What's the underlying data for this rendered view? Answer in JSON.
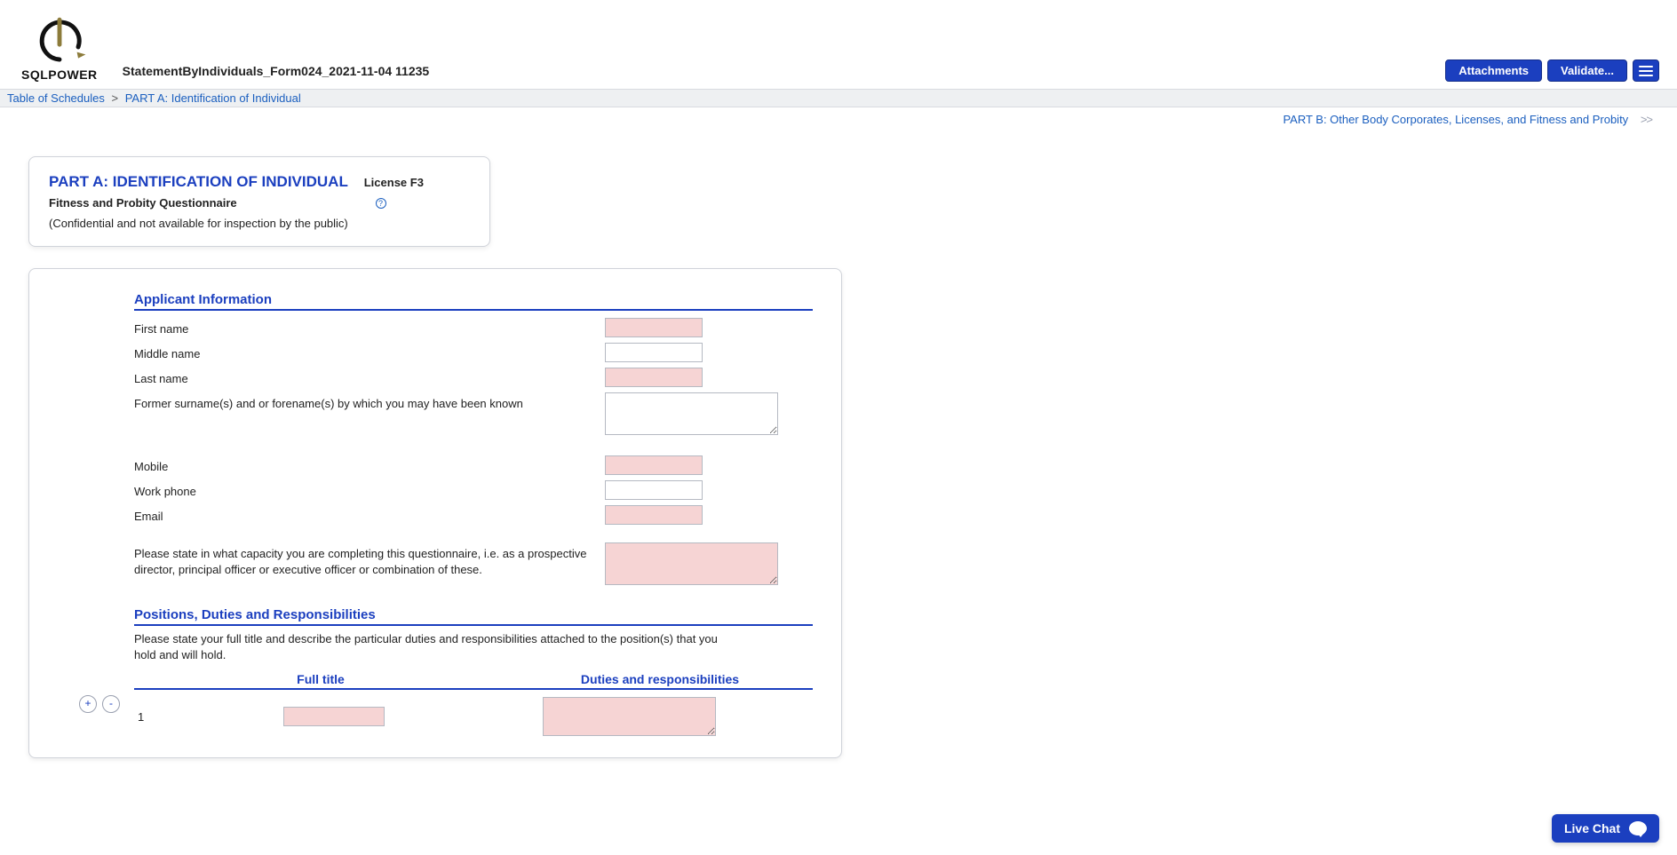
{
  "header": {
    "logo_text": "SQLPOWER",
    "form_title": "StatementByIndividuals_Form024_2021-11-04 11235",
    "buttons": {
      "attachments": "Attachments",
      "validate": "Validate..."
    }
  },
  "breadcrumb": {
    "root": "Table of Schedules",
    "current": "PART A: Identification of Individual"
  },
  "subnav": {
    "next": "PART B: Other Body Corporates, Licenses, and Fitness and Probity",
    "arrows": ">>"
  },
  "part_card": {
    "title": "PART A: IDENTIFICATION OF INDIVIDUAL",
    "license": "License F3",
    "subtitle": "Fitness and Probity Questionnaire",
    "confidential": "(Confidential and not available for inspection by the public)"
  },
  "applicant": {
    "section_title": "Applicant Information",
    "fields": {
      "first_name": {
        "label": "First name",
        "value": "",
        "required": true
      },
      "middle_name": {
        "label": "Middle name",
        "value": "",
        "required": false
      },
      "last_name": {
        "label": "Last name",
        "value": "",
        "required": true
      },
      "former_names": {
        "label": "Former surname(s) and or forename(s) by which you may have been known",
        "value": "",
        "required": false
      },
      "mobile": {
        "label": "Mobile",
        "value": "",
        "required": true
      },
      "work_phone": {
        "label": "Work phone",
        "value": "",
        "required": false
      },
      "email": {
        "label": "Email",
        "value": "",
        "required": true
      },
      "capacity": {
        "label": "Please state in what capacity you are completing this questionnaire, i.e. as a prospective director, principal officer or executive officer or combination of these.",
        "value": "",
        "required": true
      }
    }
  },
  "positions": {
    "section_title": "Positions, Duties and Responsibilities",
    "description": "Please state your full title and describe the particular duties and responsibilities attached to the position(s) that you hold and will hold.",
    "columns": {
      "col1": "Full title",
      "col2": "Duties and responsibilities"
    },
    "rows": [
      {
        "num": "1",
        "full_title": "",
        "duties": ""
      }
    ]
  },
  "live_chat": {
    "label": "Live Chat"
  }
}
